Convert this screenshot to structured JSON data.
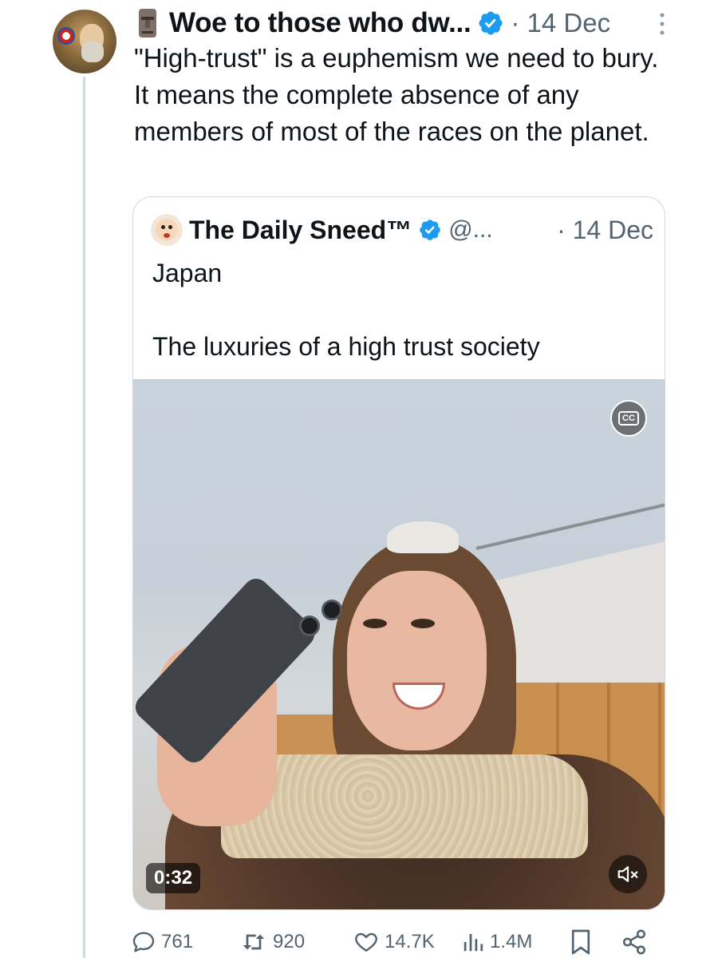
{
  "tweet": {
    "author_name": "Woe to those who dw...",
    "date": "· 14 Dec",
    "text": "\"High-trust\" is a euphemism we need to bury. It means the complete absence of any members of most of the races on the planet."
  },
  "quote": {
    "author_name": "The Daily Sneed™",
    "handle": "@...",
    "date": "· 14 Dec",
    "text_line1": "Japan",
    "text_line2": "The luxuries of a high trust society",
    "video": {
      "duration": "0:32",
      "cc_label": "CC"
    }
  },
  "actions": {
    "replies": "761",
    "reposts": "920",
    "likes": "14.7K",
    "views": "1.4M"
  },
  "colors": {
    "verified": "#1d9bf0",
    "muted_text": "#536471",
    "border": "#cfd9de"
  },
  "icons": [
    "more-icon",
    "verified-icon",
    "closed-captions-icon",
    "mute-icon",
    "reply-icon",
    "repost-icon",
    "like-icon",
    "views-icon",
    "bookmark-icon",
    "share-icon"
  ]
}
